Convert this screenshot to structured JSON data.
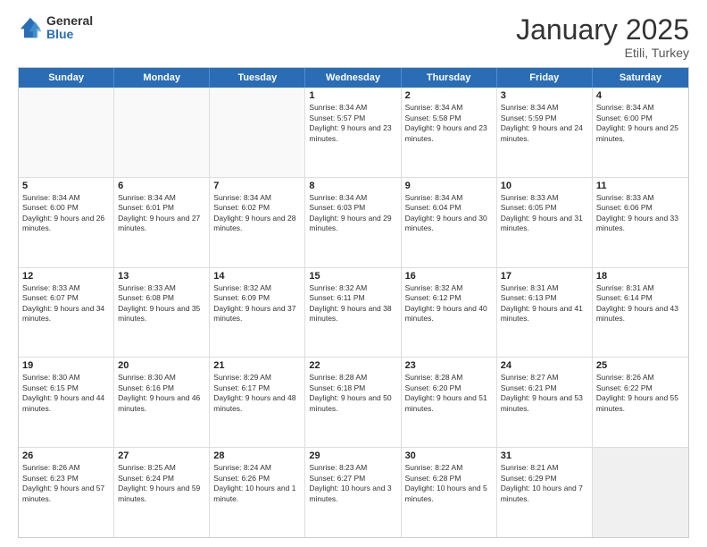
{
  "logo": {
    "general": "General",
    "blue": "Blue"
  },
  "title": {
    "month": "January 2025",
    "location": "Etili, Turkey"
  },
  "header_days": [
    "Sunday",
    "Monday",
    "Tuesday",
    "Wednesday",
    "Thursday",
    "Friday",
    "Saturday"
  ],
  "weeks": [
    [
      {
        "day": "",
        "info": ""
      },
      {
        "day": "",
        "info": ""
      },
      {
        "day": "",
        "info": ""
      },
      {
        "day": "1",
        "info": "Sunrise: 8:34 AM\nSunset: 5:57 PM\nDaylight: 9 hours and 23 minutes."
      },
      {
        "day": "2",
        "info": "Sunrise: 8:34 AM\nSunset: 5:58 PM\nDaylight: 9 hours and 23 minutes."
      },
      {
        "day": "3",
        "info": "Sunrise: 8:34 AM\nSunset: 5:59 PM\nDaylight: 9 hours and 24 minutes."
      },
      {
        "day": "4",
        "info": "Sunrise: 8:34 AM\nSunset: 6:00 PM\nDaylight: 9 hours and 25 minutes."
      }
    ],
    [
      {
        "day": "5",
        "info": "Sunrise: 8:34 AM\nSunset: 6:00 PM\nDaylight: 9 hours and 26 minutes."
      },
      {
        "day": "6",
        "info": "Sunrise: 8:34 AM\nSunset: 6:01 PM\nDaylight: 9 hours and 27 minutes."
      },
      {
        "day": "7",
        "info": "Sunrise: 8:34 AM\nSunset: 6:02 PM\nDaylight: 9 hours and 28 minutes."
      },
      {
        "day": "8",
        "info": "Sunrise: 8:34 AM\nSunset: 6:03 PM\nDaylight: 9 hours and 29 minutes."
      },
      {
        "day": "9",
        "info": "Sunrise: 8:34 AM\nSunset: 6:04 PM\nDaylight: 9 hours and 30 minutes."
      },
      {
        "day": "10",
        "info": "Sunrise: 8:33 AM\nSunset: 6:05 PM\nDaylight: 9 hours and 31 minutes."
      },
      {
        "day": "11",
        "info": "Sunrise: 8:33 AM\nSunset: 6:06 PM\nDaylight: 9 hours and 33 minutes."
      }
    ],
    [
      {
        "day": "12",
        "info": "Sunrise: 8:33 AM\nSunset: 6:07 PM\nDaylight: 9 hours and 34 minutes."
      },
      {
        "day": "13",
        "info": "Sunrise: 8:33 AM\nSunset: 6:08 PM\nDaylight: 9 hours and 35 minutes."
      },
      {
        "day": "14",
        "info": "Sunrise: 8:32 AM\nSunset: 6:09 PM\nDaylight: 9 hours and 37 minutes."
      },
      {
        "day": "15",
        "info": "Sunrise: 8:32 AM\nSunset: 6:11 PM\nDaylight: 9 hours and 38 minutes."
      },
      {
        "day": "16",
        "info": "Sunrise: 8:32 AM\nSunset: 6:12 PM\nDaylight: 9 hours and 40 minutes."
      },
      {
        "day": "17",
        "info": "Sunrise: 8:31 AM\nSunset: 6:13 PM\nDaylight: 9 hours and 41 minutes."
      },
      {
        "day": "18",
        "info": "Sunrise: 8:31 AM\nSunset: 6:14 PM\nDaylight: 9 hours and 43 minutes."
      }
    ],
    [
      {
        "day": "19",
        "info": "Sunrise: 8:30 AM\nSunset: 6:15 PM\nDaylight: 9 hours and 44 minutes."
      },
      {
        "day": "20",
        "info": "Sunrise: 8:30 AM\nSunset: 6:16 PM\nDaylight: 9 hours and 46 minutes."
      },
      {
        "day": "21",
        "info": "Sunrise: 8:29 AM\nSunset: 6:17 PM\nDaylight: 9 hours and 48 minutes."
      },
      {
        "day": "22",
        "info": "Sunrise: 8:28 AM\nSunset: 6:18 PM\nDaylight: 9 hours and 50 minutes."
      },
      {
        "day": "23",
        "info": "Sunrise: 8:28 AM\nSunset: 6:20 PM\nDaylight: 9 hours and 51 minutes."
      },
      {
        "day": "24",
        "info": "Sunrise: 8:27 AM\nSunset: 6:21 PM\nDaylight: 9 hours and 53 minutes."
      },
      {
        "day": "25",
        "info": "Sunrise: 8:26 AM\nSunset: 6:22 PM\nDaylight: 9 hours and 55 minutes."
      }
    ],
    [
      {
        "day": "26",
        "info": "Sunrise: 8:26 AM\nSunset: 6:23 PM\nDaylight: 9 hours and 57 minutes."
      },
      {
        "day": "27",
        "info": "Sunrise: 8:25 AM\nSunset: 6:24 PM\nDaylight: 9 hours and 59 minutes."
      },
      {
        "day": "28",
        "info": "Sunrise: 8:24 AM\nSunset: 6:26 PM\nDaylight: 10 hours and 1 minute."
      },
      {
        "day": "29",
        "info": "Sunrise: 8:23 AM\nSunset: 6:27 PM\nDaylight: 10 hours and 3 minutes."
      },
      {
        "day": "30",
        "info": "Sunrise: 8:22 AM\nSunset: 6:28 PM\nDaylight: 10 hours and 5 minutes."
      },
      {
        "day": "31",
        "info": "Sunrise: 8:21 AM\nSunset: 6:29 PM\nDaylight: 10 hours and 7 minutes."
      },
      {
        "day": "",
        "info": ""
      }
    ]
  ]
}
